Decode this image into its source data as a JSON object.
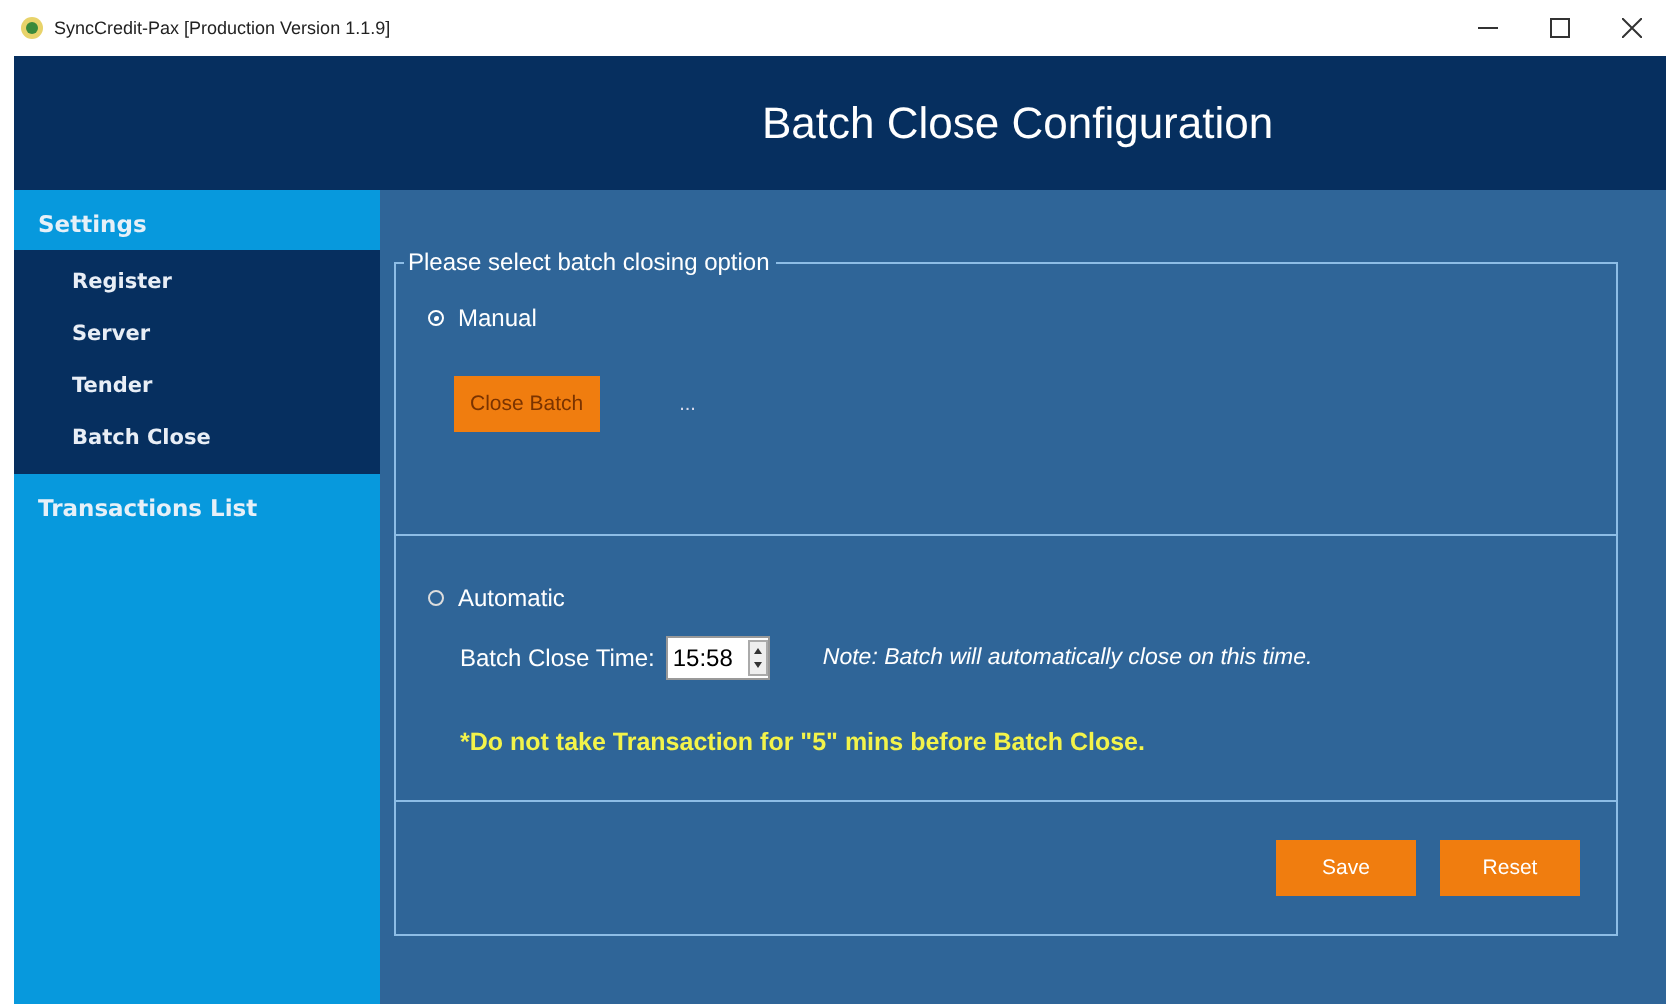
{
  "window": {
    "title": "SyncCredit-Pax [Production Version 1.1.9]"
  },
  "header": {
    "title": "Batch Close Configuration"
  },
  "sidebar": {
    "sections": [
      {
        "label": "Settings",
        "items": [
          {
            "label": "Register"
          },
          {
            "label": "Server"
          },
          {
            "label": "Tender"
          },
          {
            "label": "Batch Close"
          }
        ]
      },
      {
        "label": "Transactions List"
      }
    ]
  },
  "group": {
    "legend": "Please select batch closing option",
    "options": [
      {
        "label": "Manual",
        "selected": true
      },
      {
        "label": "Automatic",
        "selected": false
      }
    ],
    "close_batch_button": "Close Batch",
    "status": "...",
    "time_label": "Batch Close Time:",
    "time_value": "15:58",
    "note": "Note: Batch will automatically close on this time.",
    "warning": "*Do not take Transaction for \"5\" mins before Batch Close.",
    "buttons": [
      "Save",
      "Reset"
    ]
  }
}
